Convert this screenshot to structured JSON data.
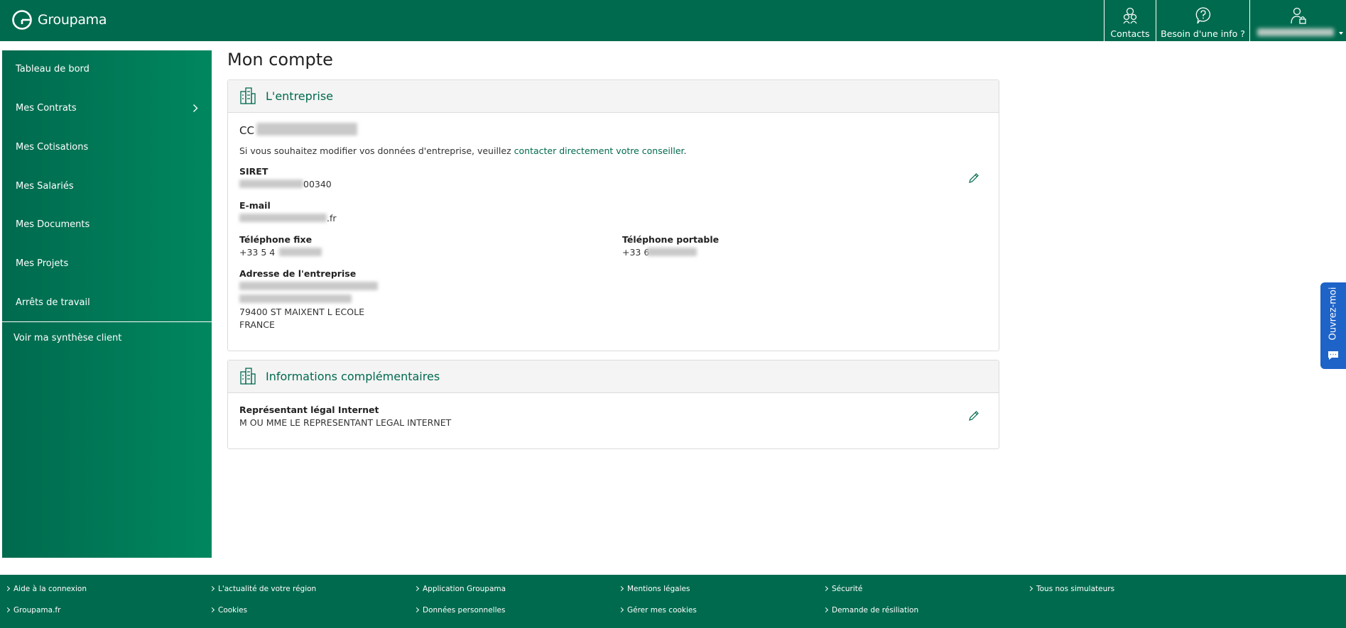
{
  "header": {
    "brand": "Groupama",
    "contacts_label": "Contacts",
    "info_label": "Besoin d'une info ?",
    "icons": {
      "logo": "groupama-logo-icon",
      "contacts": "contacts-icon",
      "info": "question-bubble-icon",
      "user": "user-lock-icon"
    }
  },
  "sidebar": {
    "items": [
      {
        "label": "Tableau de bord"
      },
      {
        "label": "Mes Contrats"
      },
      {
        "label": "Mes Cotisations"
      },
      {
        "label": "Mes Salariés"
      },
      {
        "label": "Mes Documents"
      },
      {
        "label": "Mes Projets"
      },
      {
        "label": "Arrêts de travail"
      }
    ],
    "synthese": "Voir ma synthèse client"
  },
  "main": {
    "title": "Mon compte",
    "entreprise": {
      "heading": "L'entreprise",
      "name_prefix": "CC",
      "note_text": "Si vous souhaitez modifier vos données d'entreprise, veuillez ",
      "note_link": "contacter directement votre conseiller",
      "note_end": ".",
      "siret_label": "SIRET",
      "siret_value": "00340",
      "email_label": "E-mail",
      "email_value": ".fr",
      "tel_fixe_label": "Téléphone fixe",
      "tel_fixe_value": "+33 5 4",
      "tel_portable_label": "Téléphone portable",
      "tel_portable_value": "+33 6",
      "adresse_label": "Adresse de l'entreprise",
      "adresse_line3": "79400 ST MAIXENT L ECOLE",
      "adresse_line4": "FRANCE"
    },
    "complementaires": {
      "heading": "Informations complémentaires",
      "rep_label": "Représentant légal Internet",
      "rep_value": "M OU MME LE REPRESENTANT LEGAL INTERNET"
    }
  },
  "feedback": {
    "label": "Ouvrez-moi"
  },
  "footer": {
    "row1": [
      "Aide à la connexion",
      "L'actualité de votre région",
      "Application Groupama",
      "Mentions légales",
      "Sécurité",
      "Tous nos simulateurs"
    ],
    "row2": [
      "Groupama.fr",
      "Cookies",
      "Données personnelles",
      "Gérer mes cookies",
      "Demande de résiliation"
    ]
  },
  "colors": {
    "brand_green": "#006a4e",
    "feedback_blue": "#1e63c7"
  }
}
